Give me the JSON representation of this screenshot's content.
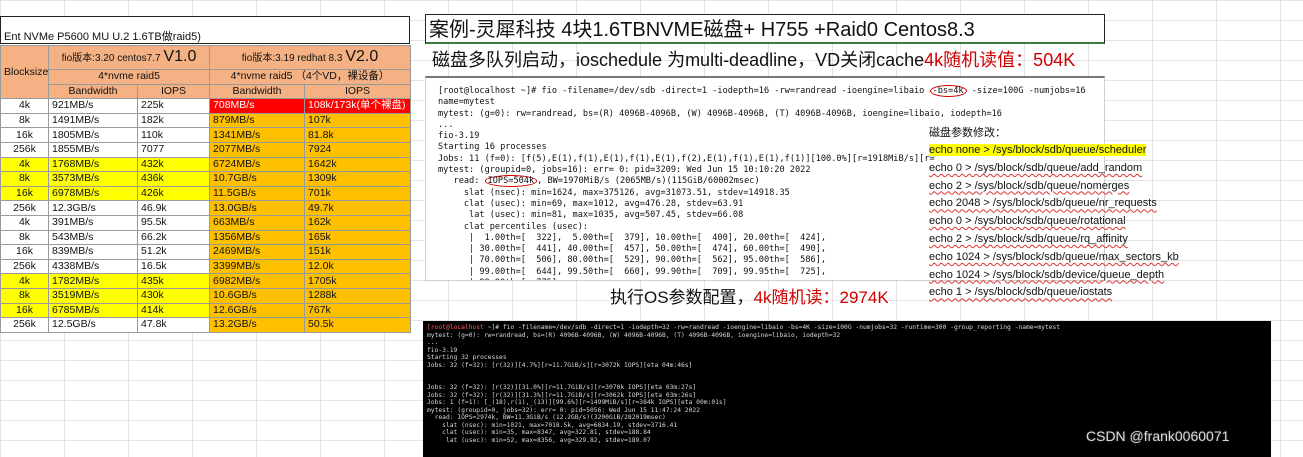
{
  "left_panel": {
    "title": "Ent NVMe P5600 MU U.2  1.6TB做raid5)",
    "header": {
      "blocksize": "Blocksize",
      "v1_desc": "fio版本:3.20  centos7.7",
      "v1_ver": "V1.0",
      "v2_desc": "fio版本:3.19  redhat 8.3",
      "v2_ver": "V2.0",
      "v1_config": "4*nvme raid5",
      "v2_config": "4*nvme raid5  （4个VD，裸设备）",
      "bandwidth": "Bandwidth",
      "iops": "IOPS"
    },
    "rows": [
      {
        "bs": "4k",
        "bw1": "921MB/s",
        "iops1": "225k",
        "bw2": "708MB/s",
        "iops2": "108k/173k(单个裸盘)",
        "style": "white",
        "special": "red"
      },
      {
        "bs": "8k",
        "bw1": "1491MB/s",
        "iops1": "182k",
        "bw2": "879MB/s",
        "iops2": "107k",
        "style": "white"
      },
      {
        "bs": "16k",
        "bw1": "1805MB/s",
        "iops1": "110k",
        "bw2": "1341MB/s",
        "iops2": "81.8k",
        "style": "white"
      },
      {
        "bs": "256k",
        "bw1": "1855MB/s",
        "iops1": "7077",
        "bw2": "2077MB/s",
        "iops2": "7924",
        "style": "white"
      },
      {
        "bs": "4k",
        "bw1": "1768MB/s",
        "iops1": "432k",
        "bw2": "6724MB/s",
        "iops2": "1642k",
        "style": "yellow"
      },
      {
        "bs": "8k",
        "bw1": "3573MB/s",
        "iops1": "436k",
        "bw2": "10.7GB/s",
        "iops2": "1309k",
        "style": "yellow"
      },
      {
        "bs": "16k",
        "bw1": "6978MB/s",
        "iops1": "426k",
        "bw2": "11.5GB/s",
        "iops2": "701k",
        "style": "yellow"
      },
      {
        "bs": "256k",
        "bw1": "12.3GB/s",
        "iops1": "46.9k",
        "bw2": "13.0GB/s",
        "iops2": "49.7k",
        "style": "white"
      },
      {
        "bs": "4k",
        "bw1": "391MB/s",
        "iops1": "95.5k",
        "bw2": "663MB/s",
        "iops2": "162k",
        "style": "white"
      },
      {
        "bs": "8k",
        "bw1": "543MB/s",
        "iops1": "66.2k",
        "bw2": "1356MB/s",
        "iops2": "165k",
        "style": "white"
      },
      {
        "bs": "16k",
        "bw1": "839MB/s",
        "iops1": "51.2k",
        "bw2": "2469MB/s",
        "iops2": "151k",
        "style": "white"
      },
      {
        "bs": "256k",
        "bw1": "4338MB/s",
        "iops1": "16.5k",
        "bw2": "3399MB/s",
        "iops2": "12.0k",
        "style": "white"
      },
      {
        "bs": "4k",
        "bw1": "1782MB/s",
        "iops1": "435k",
        "bw2": "6982MB/s",
        "iops2": "1705k",
        "style": "yellow"
      },
      {
        "bs": "8k",
        "bw1": "3519MB/s",
        "iops1": "430k",
        "bw2": "10.6GB/s",
        "iops2": "1288k",
        "style": "yellow"
      },
      {
        "bs": "16k",
        "bw1": "6785MB/s",
        "iops1": "414k",
        "bw2": "12.6GB/s",
        "iops2": "767k",
        "style": "yellow"
      },
      {
        "bs": "256k",
        "bw1": "12.5GB/s",
        "iops1": "47.8k",
        "bw2": "13.2GB/s",
        "iops2": "50.5k",
        "style": "white"
      }
    ]
  },
  "right_panel": {
    "case_title": "案例-灵犀科技 4块1.6TBNVME磁盘+ H755 +Raid0 Centos8.3",
    "subtitle_main": "磁盘多队列启动，ioschedule 为multi-deadline，VD关闭cache",
    "subtitle_red": "4k随机读值：504K",
    "terminal1": {
      "cmd_pre": "[root@localhost ~]# fio -filename=/dev/sdb -direct=1 -iodepth=16 -rw=randread -ioengine=libaio ",
      "cmd_circle": "-bs=4k",
      "cmd_post": " -size=100G -numjobs=16",
      "lines": [
        "name=mytest",
        "mytest: (g=0): rw=randread, bs=(R) 4096B-4096B, (W) 4096B-4096B, (T) 4096B-4096B, ioengine=libaio, iodepth=16",
        "...",
        "fio-3.19",
        "Starting 16 processes",
        "Jobs: 11 (f=0): [f(5),E(1),f(1),E(1),f(1),E(1),f(2),E(1),f(1),E(1),f(1)][100.0%][r=1918MiB/s][r=",
        "mytest: (groupid=0, jobs=16): err= 0: pid=3209: Wed Jun 15 10:10:20 2022"
      ],
      "read_pre": "   read: ",
      "read_circle": "IOPS=504k",
      "read_post": ", BW=1970MiB/s (2065MB/s)(115GiB/60002msec)",
      "lines2": [
        "     slat (nsec): min=1624, max=375126, avg=31073.51, stdev=14918.35",
        "     clat (usec): min=69, max=1012, avg=476.28, stdev=63.91",
        "      lat (usec): min=81, max=1035, avg=507.45, stdev=66.08",
        "     clat percentiles (usec):",
        "      |  1.00th=[  322],  5.00th=[  379], 10.00th=[  400], 20.00th=[  424],",
        "      | 30.00th=[  441], 40.00th=[  457], 50.00th=[  474], 60.00th=[  490],",
        "      | 70.00th=[  506], 80.00th=[  529], 90.00th=[  562], 95.00th=[  586],",
        "      | 99.00th=[  644], 99.50th=[  660], 99.90th=[  709], 99.95th=[  725],",
        "      | 99.99th=[  775]"
      ]
    },
    "params_title": "磁盘参数修改：",
    "params": [
      "echo none > /sys/block/sdb/queue/scheduler",
      "echo 0 > /sys/block/sdb/queue/add_random",
      "echo 2 > /sys/block/sdb/queue/nomerges",
      "echo 2048 > /sys/block/sdb/queue/nr_requests",
      "echo 0 > /sys/block/sdb/queue/rotational",
      "echo 2 > /sys/block/sdb/queue/rq_affinity",
      "echo 1024 > /sys/block/sdb/queue/max_sectors_kb",
      "echo 1024 > /sys/block/sdb/device/queue_depth",
      "echo 1 > /sys/block/sdb/queue/iostats"
    ],
    "os_config_main": "执行OS参数配置，",
    "os_config_red": "4k随机读：2974K"
  },
  "terminal2": {
    "prompt_user": "[root@localhost",
    "prompt_rest": " ~]# fio -filename=/dev/sdb -direct=1 -iodepth=32 -rw=randread -ioengine=libaio -bs=4K -size=100G -numjobs=32 -runtime=300 -group_reporting -name=mytest",
    "lines": [
      "mytest: (g=0): rw=randread, bs=(R) 4096B-4096B, (W) 4096B-4096B, (T) 4096B-4096B, ioengine=libaio, iodepth=32",
      "...",
      "fio-3.19",
      "Starting 32 processes",
      "Jobs: 32 (f=32): [r(32)][4.7%][r=11.7GiB/s][r=3072k IOPS][eta 04m:46s]",
      "",
      "",
      "Jobs: 32 (f=32): [r(32)][31.0%][r=11.7GiB/s][r=3070k IOPS][eta 03m:27s]",
      "Jobs: 32 (f=32): [r(32)][31.3%][r=11.7GiB/s][r=3062k IOPS][eta 03m:26s]",
      "Jobs: 1 (f=1): [_(18),r(1),_(13)][99.6%][r=1499MiB/s][r=384k IOPS][eta 00m:01s]",
      "mytest: (groupid=0, jobs=32): err= 0: pid=5056: Wed Jun 15 11:47:24 2022",
      "  read: IOPS=2974k, BW=11.3GiB/s (12.2GB/s)(3200GiB/282019msec)",
      "    slat (nsec): min=1021, max=7018.5k, avg=6834.19, stdev=3716.41",
      "    clat (usec): min=35, max=8347, avg=322.81, stdev=188.84",
      "     lat (usec): min=52, max=8356, avg=329.82, stdev=189.07"
    ]
  },
  "watermark": "CSDN @frank0060071",
  "colors": {
    "header_orange": "#f4b183",
    "cell_orange": "#ffc000",
    "cell_yellow": "#ffff00",
    "cell_red": "#ff0000",
    "accent_red": "#d00000"
  }
}
